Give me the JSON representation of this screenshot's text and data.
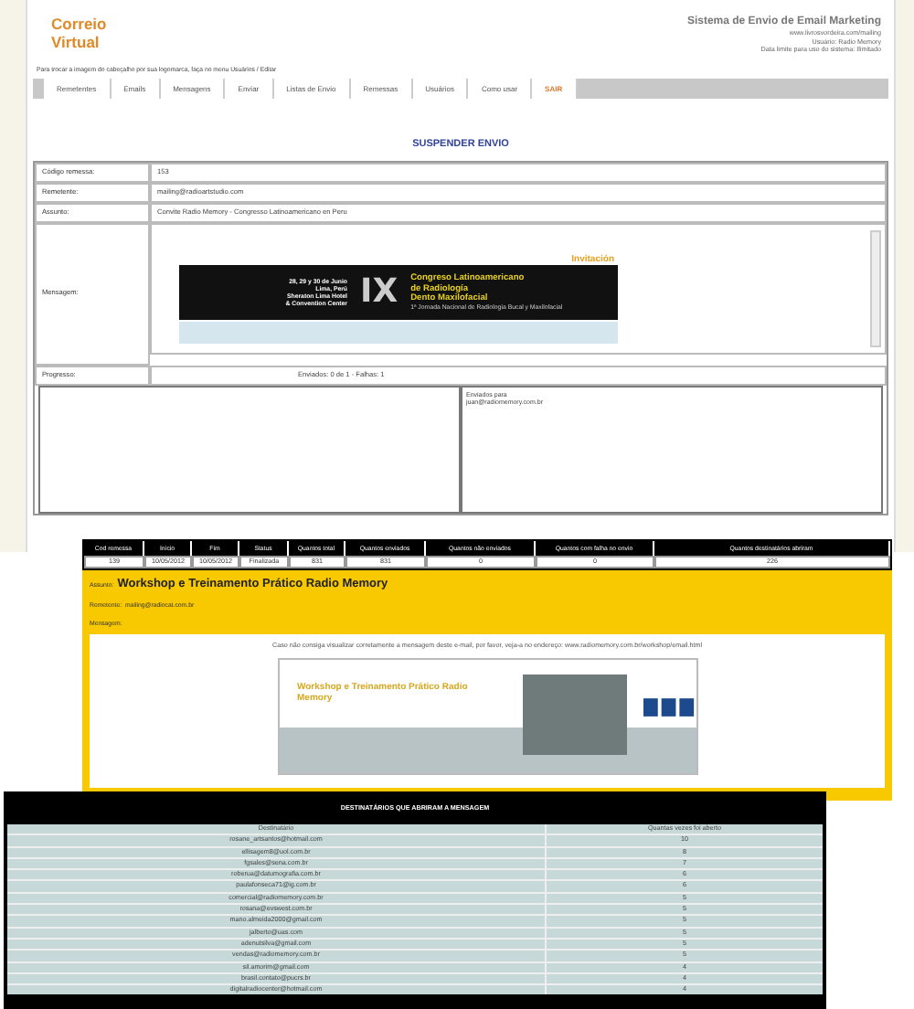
{
  "main_window": {
    "logo": [
      "Correio",
      "Virtual"
    ],
    "system_title": "Sistema de Envio de Email Marketing",
    "site_url": "www.livrosvordeira.com/mailing",
    "user": "Usuário: Radio Memory",
    "limit": "Data limite para uso do sistema: Ilimitado",
    "header_hint": "Para trocar a imagem do cabeçalho por sua logomarca, faça no menu Usuários / Editar",
    "menu": [
      {
        "label": "Remetentes",
        "kind": "normal"
      },
      {
        "label": "Emails",
        "kind": "normal"
      },
      {
        "label": "Mensagens",
        "kind": "normal"
      },
      {
        "label": "Enviar",
        "kind": "normal"
      },
      {
        "label": "Listas de Envio",
        "kind": "normal"
      },
      {
        "label": "Remessas",
        "kind": "normal"
      },
      {
        "label": "Usuários",
        "kind": "normal"
      },
      {
        "label": "Como usar",
        "kind": "normal"
      },
      {
        "label": "SAIR",
        "kind": "exit"
      }
    ],
    "page_title": "SUSPENDER ENVIO",
    "fields": [
      {
        "label": "Código remessa:",
        "value": "153"
      },
      {
        "label": "Remetente:",
        "value": "mailing@radioartstudio.com"
      },
      {
        "label": "Assunto:",
        "value": "Convite Radio Memory - Congresso Latinoamericano en Peru"
      }
    ],
    "message": {
      "label": "Mensagem:",
      "banner": {
        "heading": "Invitación",
        "event_info": [
          "28, 29 y 30 de Junio",
          "Lima, Perú",
          "Sheraton Lima Hotel",
          "& Convention Center"
        ],
        "edition": "IX",
        "event_title": [
          "Congreso Latinoamericano",
          "de Radiología",
          "Dento Maxilofacial"
        ],
        "subtitle": "1ª Jornada Nacional de Radiología Bucal y Maxilofacial"
      }
    },
    "progress": {
      "label": "Progresso:",
      "value": "Enviados: 0 de 1 - Falhas: 1"
    },
    "log": [
      "Enviados para",
      "juan@radiomemory.com.br"
    ]
  },
  "report": {
    "columns": [
      "Cod remessa",
      "Início",
      "Fim",
      "Status",
      "Quantos total",
      "Quantos enviados",
      "Quantos não enviados",
      "Quantos com falha no envio",
      "Quantos destinatários abriram"
    ],
    "row": [
      "139",
      "10/05/2012",
      "10/05/2012",
      "Finalizada",
      "831",
      "831",
      "0",
      "0",
      "226"
    ],
    "subject": {
      "label": "Assunto:",
      "value": "Workshop e Treinamento Prático Radio Memory"
    },
    "sender": {
      "label": "Remetente:",
      "value": "mailing@radiocat.com.br"
    },
    "message_label": "Mensagem:",
    "notice": "Caso não consiga visualizar corretamente a mensagem deste e-mail, por favor, veja-a no endereço: www.radiomemory.com.br/workshop/email.html",
    "email_headline": "Workshop e Treinamento Prático Radio Memory"
  },
  "openers": {
    "title": "DESTINATÁRIOS QUE ABRIRAM A MENSAGEM",
    "columns": [
      "Destinatário",
      "Quantas vezes foi aberto"
    ],
    "rows": [
      [
        "rosane_artsantos@hotmail.com",
        "10"
      ],
      [
        "ellisagem8@uol.com.br",
        "8"
      ],
      [
        "fgsales@sena.com.br",
        "7"
      ],
      [
        "roberua@datumografia.com.br",
        "6"
      ],
      [
        "paulafonseca71@ig.com.br",
        "6"
      ],
      [
        "comercial@radiomemory.com.br",
        "5"
      ],
      [
        "rosana@evswest.com.br",
        "5"
      ],
      [
        "mano.almeida2000@gmail.com",
        "5"
      ],
      [
        "jalberto@uas.com",
        "5"
      ],
      [
        "adenutsilva@gmail.com",
        "5"
      ],
      [
        "vendas@radiomemory.com.br",
        "5"
      ],
      [
        "sil.amorim@gmail.com",
        "4"
      ],
      [
        "brasil.contato@pucrs.br",
        "4"
      ],
      [
        "digitalradiocenter@hotmail.com",
        "4"
      ]
    ]
  }
}
